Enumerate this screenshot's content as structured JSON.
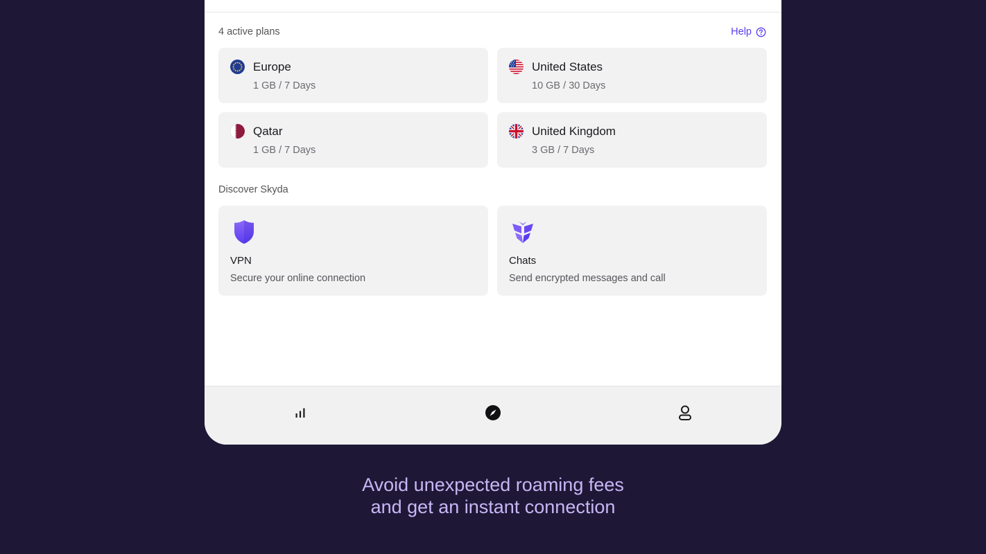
{
  "plans": {
    "heading": "4 active plans",
    "help_label": "Help",
    "items": [
      {
        "name": "Europe",
        "detail": "1 GB / 7 Days",
        "flag": "eu-flag-icon"
      },
      {
        "name": "United States",
        "detail": "10 GB / 30 Days",
        "flag": "us-flag-icon"
      },
      {
        "name": "Qatar",
        "detail": "1 GB / 7 Days",
        "flag": "qatar-flag-icon"
      },
      {
        "name": "United Kingdom",
        "detail": "3 GB / 7 Days",
        "flag": "uk-flag-icon"
      }
    ]
  },
  "discover": {
    "heading": "Discover Skyda",
    "items": [
      {
        "title": "VPN",
        "description": "Secure your online connection",
        "icon": "shield-icon"
      },
      {
        "title": "Chats",
        "description": "Send encrypted messages and call",
        "icon": "chats-logo-icon"
      }
    ]
  },
  "nav": {
    "items": [
      {
        "icon": "bar-chart-icon"
      },
      {
        "icon": "compass-icon"
      },
      {
        "icon": "profile-icon"
      }
    ]
  },
  "tagline": {
    "line1": "Avoid unexpected roaming fees",
    "line2": "and get an instant connection"
  },
  "colors": {
    "background": "#1e1836",
    "accent": "#5b3cf0",
    "card": "#f2f2f3",
    "tagline": "#c7b6f5"
  }
}
